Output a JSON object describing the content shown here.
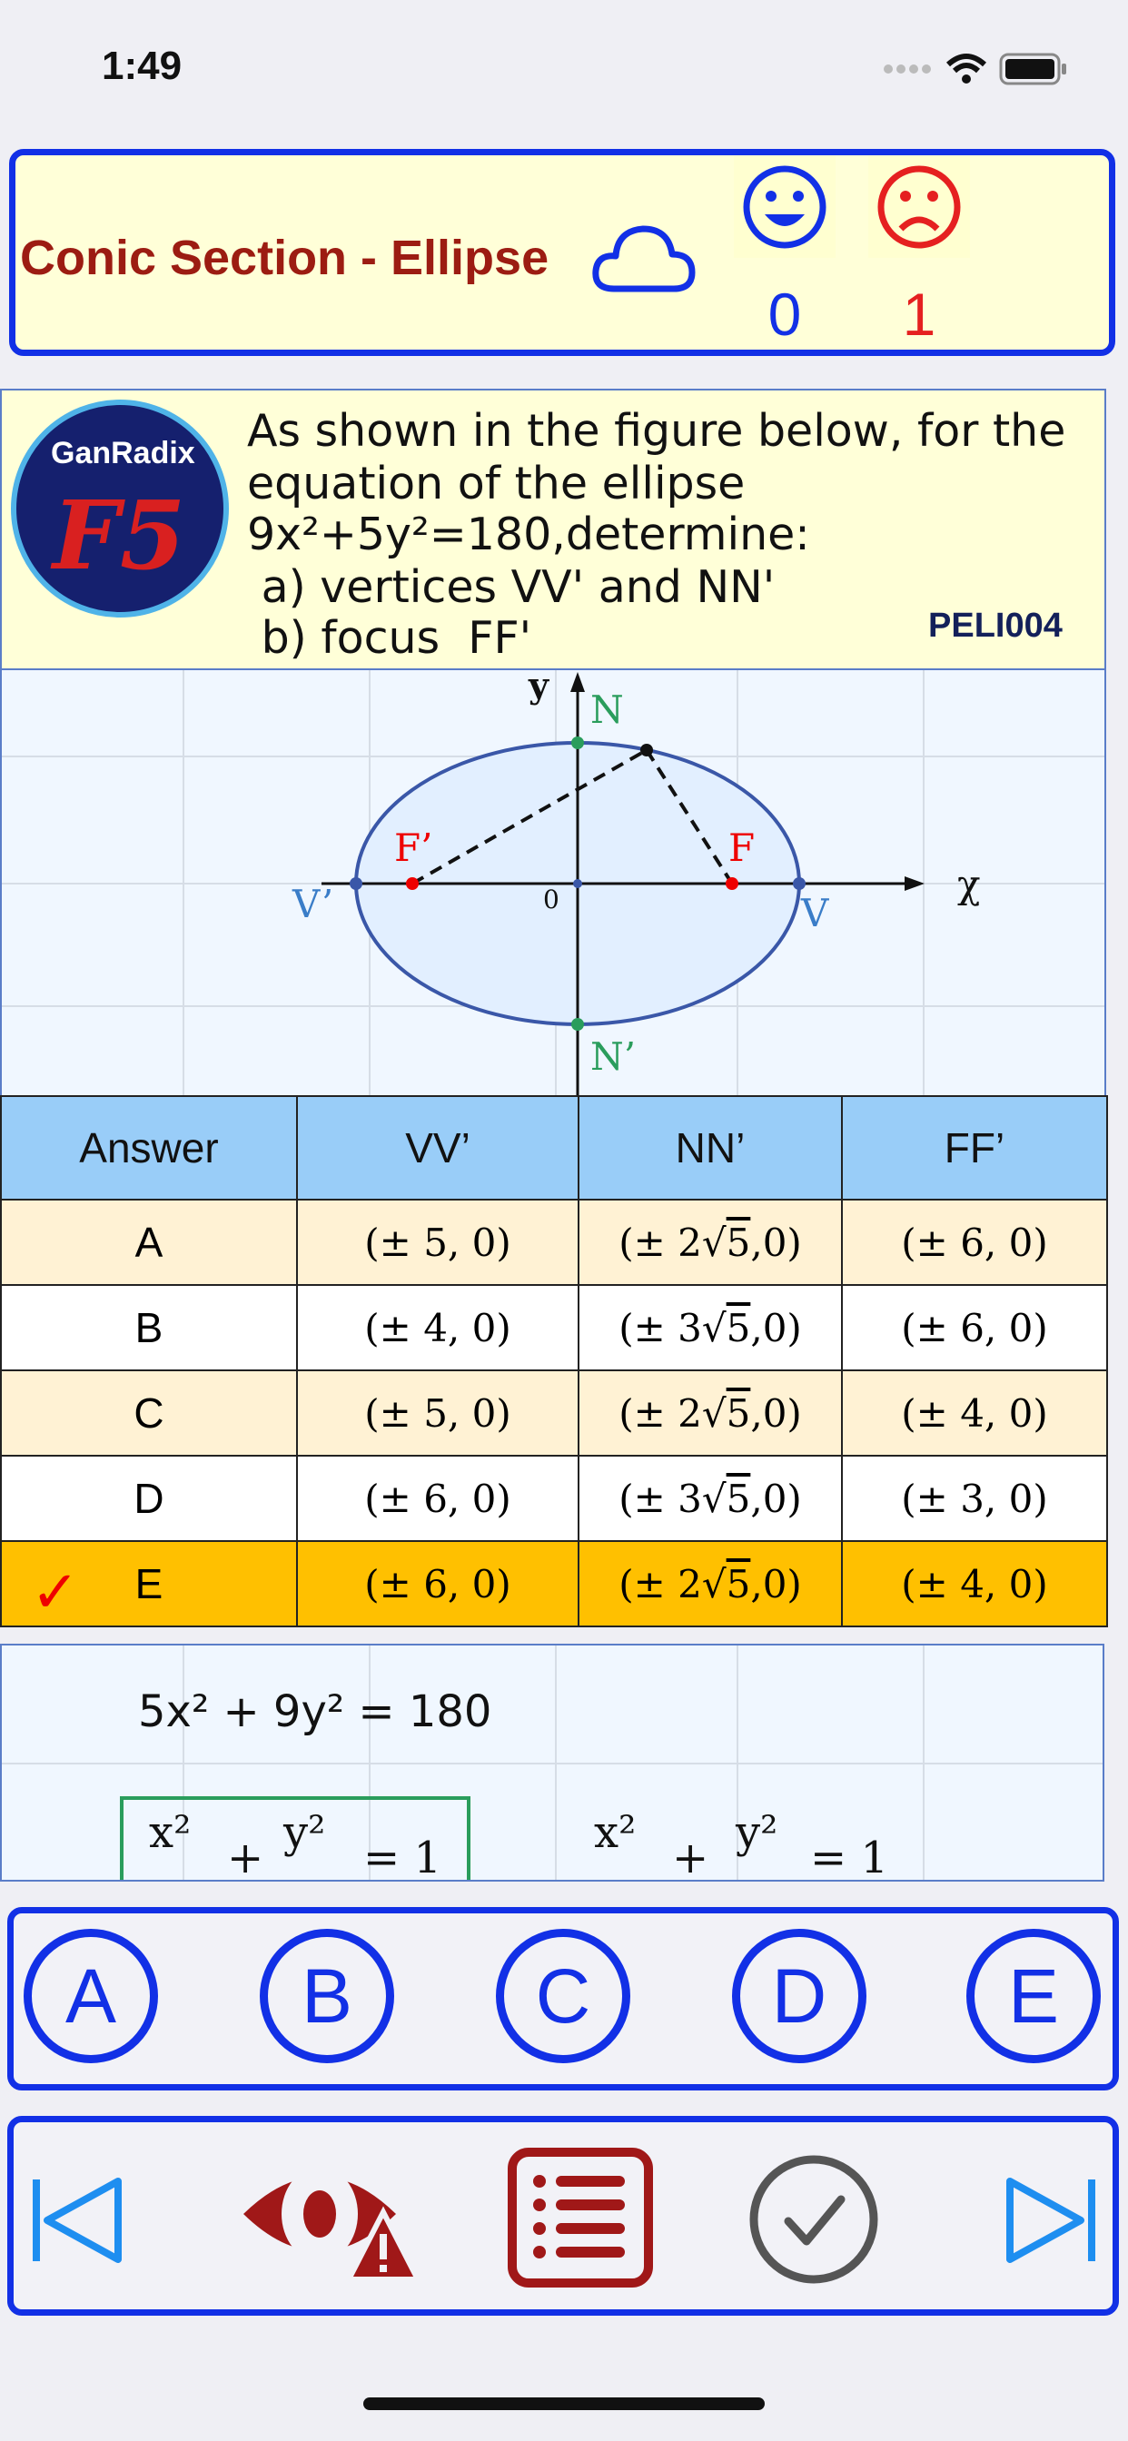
{
  "status_bar": {
    "time": "1:49"
  },
  "header": {
    "title": "Conic Section - Ellipse",
    "correct_count": "0",
    "wrong_count": "1",
    "icons": [
      "cloud-icon",
      "happy-face-icon",
      "sad-face-icon"
    ]
  },
  "logo": {
    "brand": "GanRadix",
    "mark": "F5"
  },
  "question": {
    "lines": [
      "As shown in the figure below, for the",
      "equation of the ellipse",
      "9x²+5y²=180,determine:",
      " a) vertices VV' and NN'",
      " b) focus  FF'"
    ],
    "code": "PELI004"
  },
  "figure": {
    "labels": {
      "y": "y",
      "x": "χ",
      "n": "N",
      "n2": "N’",
      "f": "F",
      "f2": "F’",
      "v": "V",
      "v2": "V’",
      "origin": "0"
    }
  },
  "answer_table": {
    "headers": [
      "Answer",
      "VV’",
      "NN’",
      "FF’"
    ],
    "rows": [
      {
        "label": "A",
        "vv": "(± 5, 0)",
        "nn_coef": "(± 2",
        "ff": "(± 6, 0)"
      },
      {
        "label": "B",
        "vv": "(± 4, 0)",
        "nn_coef": "(± 3",
        "ff": "(± 6, 0)"
      },
      {
        "label": "C",
        "vv": "(± 5, 0)",
        "nn_coef": "(± 2",
        "ff": "(± 4, 0)"
      },
      {
        "label": "D",
        "vv": "(± 6, 0)",
        "nn_coef": "(± 3",
        "ff": "(± 3, 0)"
      },
      {
        "label": "E",
        "vv": "(± 6, 0)",
        "nn_coef": "(± 2",
        "ff": "(± 4, 0)"
      }
    ],
    "radical": "5",
    "nn_tail": ",0)",
    "check_mark": "✓"
  },
  "solution": {
    "equation": "5x² + 9y² = 180",
    "frac_num_x": "x²",
    "frac_num_y": "y²",
    "plus": "+",
    "equals_one": "= 1"
  },
  "choices": [
    "A",
    "B",
    "C",
    "D",
    "E"
  ],
  "navbar_icons": [
    "first-icon",
    "hide-warning-icon",
    "list-icon",
    "check-circle-icon",
    "last-icon"
  ],
  "colors": {
    "accent": "#1230e6",
    "header_bg": "#ffffd8",
    "title": "#9c1c12",
    "selected_row": "#ffc000"
  }
}
